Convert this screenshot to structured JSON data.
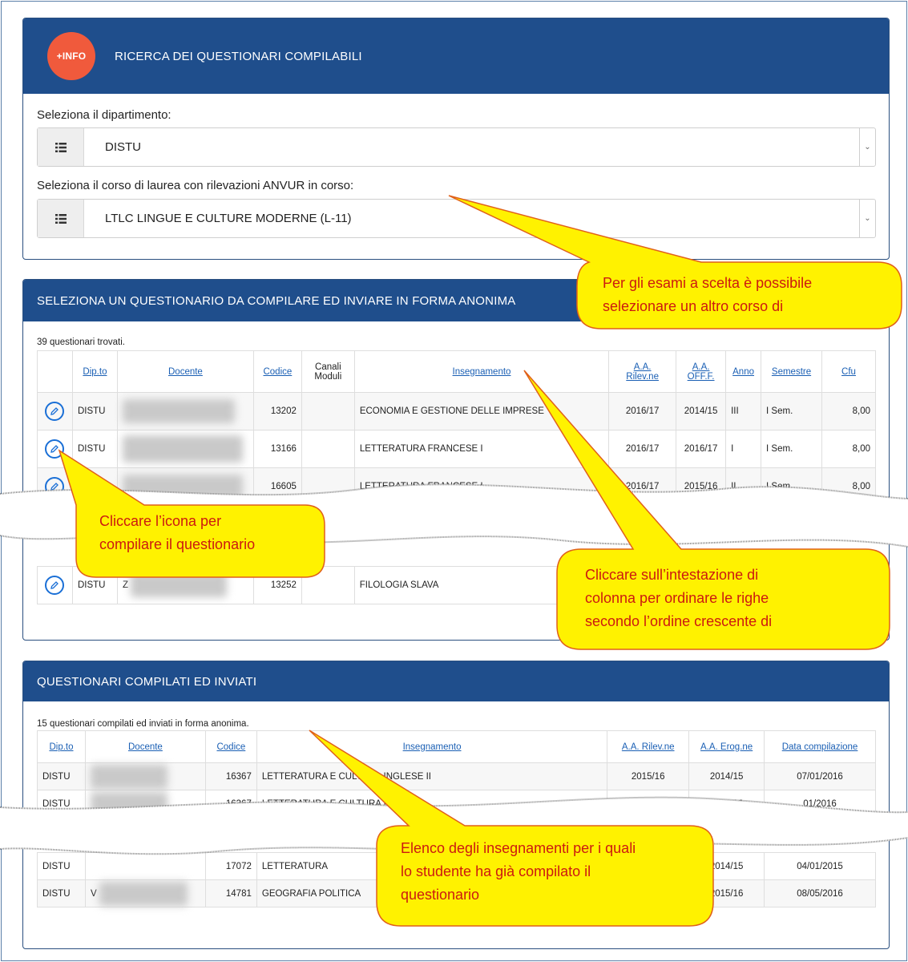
{
  "panel1": {
    "badge": "+INFO",
    "title": "RICERCA DEI QUESTIONARI COMPILABILI",
    "dept_label": "Seleziona il dipartimento:",
    "dept_value": "DISTU",
    "course_label": "Seleziona il corso di laurea con rilevazioni ANVUR in corso:",
    "course_value": "LTLC LINGUE E CULTURE MODERNE (L-11)",
    "list_icon": "list-icon",
    "dropdown_icon": "chevron-down-icon"
  },
  "panel2": {
    "title": "SELEZIONA UN QUESTIONARIO DA COMPILARE ED INVIARE IN FORMA ANONIMA",
    "count": "39 questionari trovati.",
    "headers": {
      "dipto": "Dip.to",
      "docente": "Docente",
      "codice": "Codice",
      "canali_1": "Canali",
      "canali_2": "Moduli",
      "insegnamento": "Insegnamento",
      "aa_rilev_1": "A.A.",
      "aa_rilev_2": "Rilev.ne",
      "aa_off_1": "A.A.",
      "aa_off_2": "OFF.F.",
      "anno": "Anno",
      "semestre": "Semestre",
      "cfu": "Cfu"
    },
    "rows": [
      {
        "dipto": "DISTU",
        "codice": "13202",
        "insegnamento": "ECONOMIA E GESTIONE DELLE IMPRESE",
        "aa_rilev": "2016/17",
        "aa_off": "2014/15",
        "anno": "III",
        "semestre": "I Sem.",
        "cfu": "8,00"
      },
      {
        "dipto": "DISTU",
        "codice": "13166",
        "insegnamento": "LETTERATURA FRANCESE I",
        "aa_rilev": "2016/17",
        "aa_off": "2016/17",
        "anno": "I",
        "semestre": "I Sem.",
        "cfu": "8,00"
      },
      {
        "dipto": "DISTU",
        "codice": "16605",
        "insegnamento": "LETTERATURA FRANCESE I",
        "aa_rilev": "2016/17",
        "aa_off": "2015/16",
        "anno": "II",
        "semestre": "I Sem.",
        "cfu": "8,00"
      },
      {
        "dipto": "DISTU",
        "docente_initial": "Z",
        "codice": "13252",
        "insegnamento": "FILOLOGIA SLAVA"
      }
    ],
    "edit_icon": "pencil-icon"
  },
  "panel3": {
    "title": "QUESTIONARI COMPILATI ED INVIATI",
    "count": "15 questionari compilati ed inviati in forma anonima.",
    "headers": {
      "dipto": "Dip.to",
      "docente": "Docente",
      "codice": "Codice",
      "insegnamento": "Insegnamento",
      "aa_rilev": "A.A. Rilev.ne",
      "aa_erog": "A.A. Erog.ne",
      "data": "Data compilazione"
    },
    "rows": [
      {
        "dipto": "DISTU",
        "codice": "16367",
        "insegnamento": "LETTERATURA E CULTURA INGLESE II",
        "aa_rilev": "2015/16",
        "aa_erog": "2014/15",
        "data": "07/01/2016"
      },
      {
        "dipto": "DISTU",
        "codice": "16367",
        "insegnamento": "LETTERATURA E CULTURA INGLESE",
        "aa_rilev": "2016/17",
        "aa_erog": "2015/16",
        "data": "01/2016"
      },
      {
        "dipto": "DISTU",
        "codice": "17072",
        "insegnamento": "LETTERATURA",
        "aa_rilev": "",
        "aa_erog": "2014/15",
        "data": "04/01/2015"
      },
      {
        "dipto": "DISTU",
        "docente_initial": "V",
        "codice": "14781",
        "insegnamento": "GEOGRAFIA POLITICA",
        "aa_rilev": "",
        "aa_erog": "2015/16",
        "data": "08/05/2016"
      }
    ]
  },
  "callouts": {
    "c1": [
      "Per gli esami a scelta è possibile",
      "selezionare un altro corso di"
    ],
    "c2": [
      "Cliccare l’icona per",
      "compilare il questionario"
    ],
    "c3": [
      "Cliccare sull’intestazione di",
      "colonna per ordinare le righe",
      "secondo l’ordine crescente di"
    ],
    "c4": [
      "Elenco degli insegnamenti per i quali",
      "lo studente ha già compilato il",
      "questionario"
    ]
  },
  "colors": {
    "header_bg": "#1f4e8c",
    "badge": "#f05a3c",
    "link": "#1a5fb4",
    "callout_fill": "#fff200",
    "callout_border": "#e0601a",
    "callout_text": "#cc1a10"
  }
}
